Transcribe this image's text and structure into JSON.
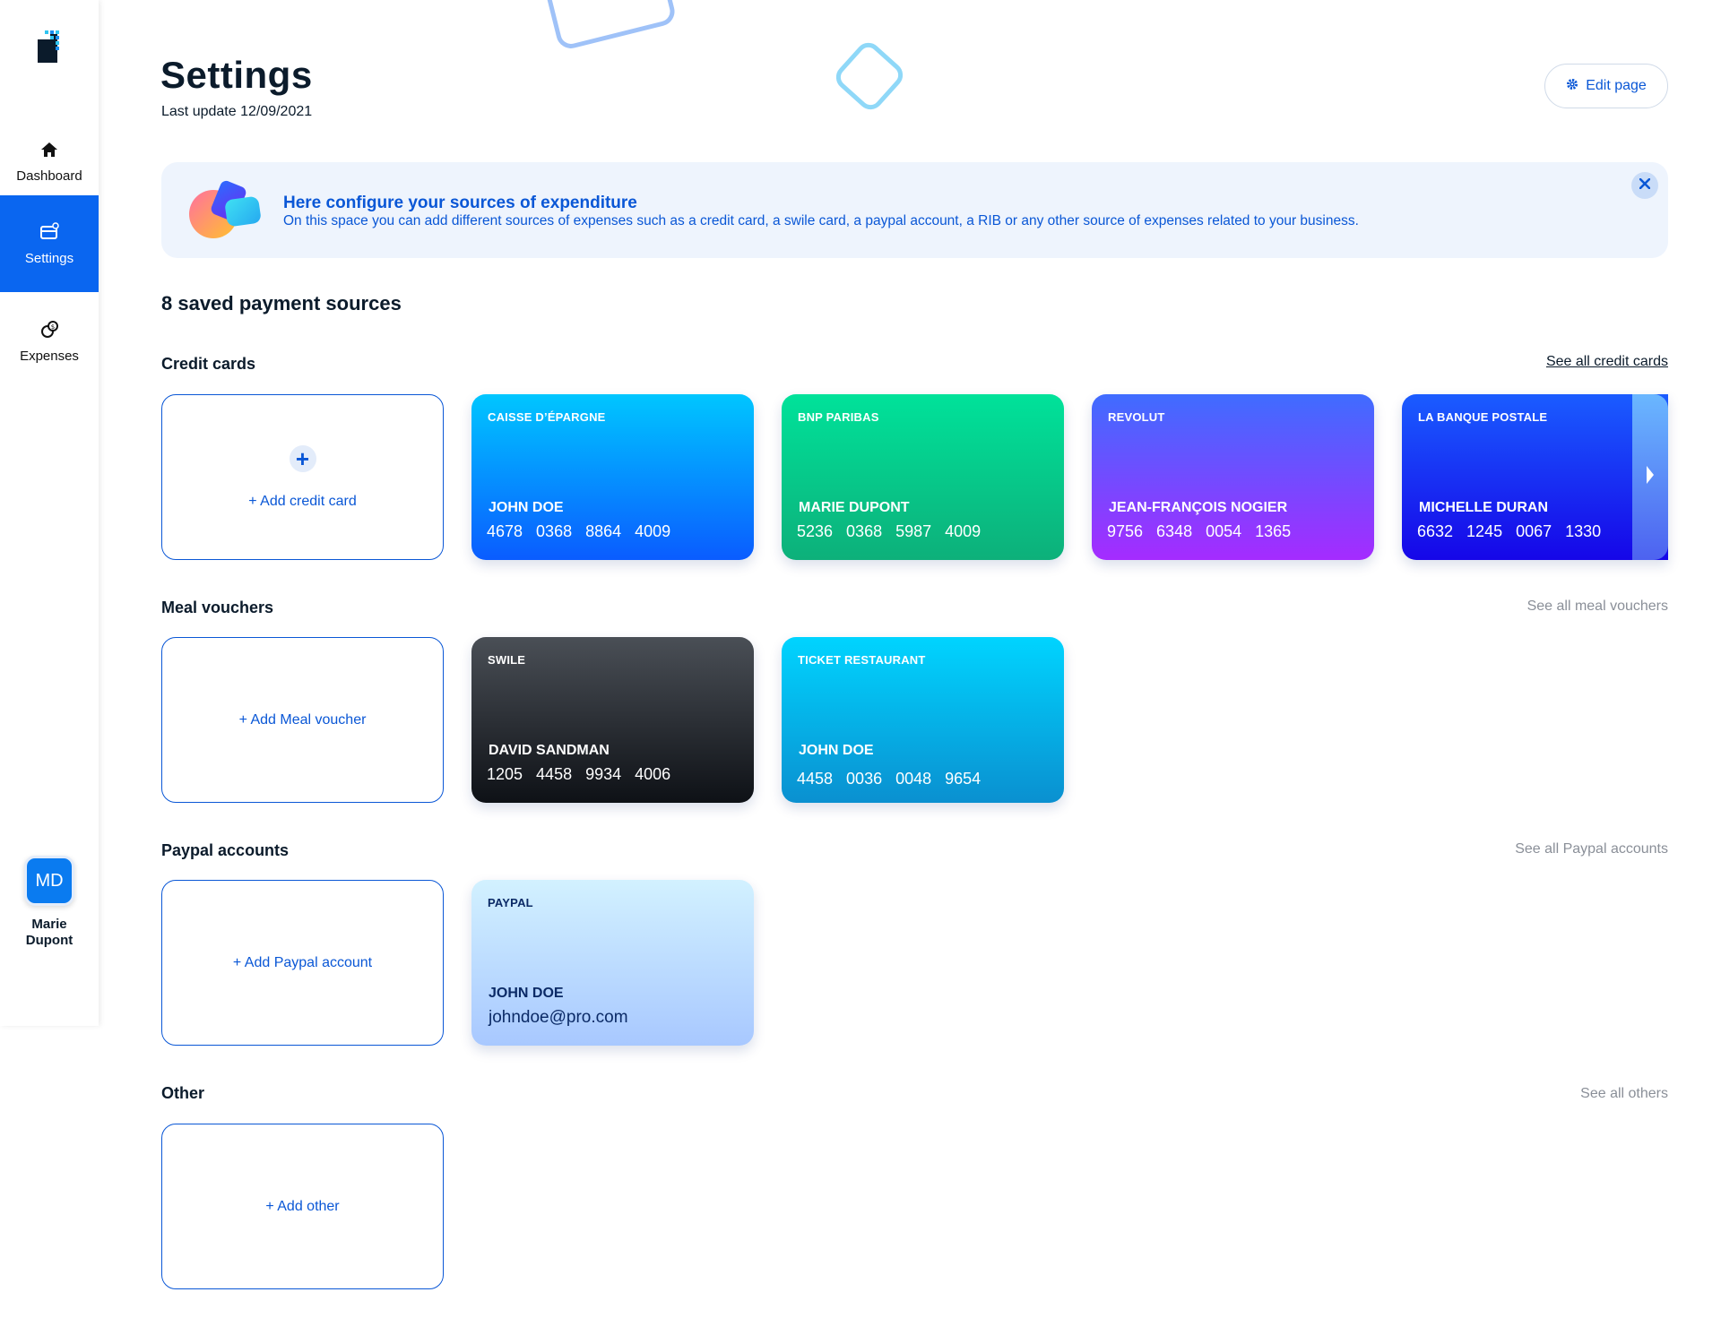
{
  "sidebar": {
    "items": [
      {
        "label": "Dashboard",
        "icon": "home-icon"
      },
      {
        "label": "Settings",
        "icon": "settings-card-icon"
      },
      {
        "label": "Expenses",
        "icon": "expenses-icon"
      }
    ],
    "user": {
      "initials": "MD",
      "first_name": "Marie",
      "last_name": "Dupont"
    }
  },
  "header": {
    "title": "Settings",
    "subtitle": "Last update 12/09/2021",
    "edit_label": "Edit page"
  },
  "banner": {
    "title": "Here configure your sources of expenditure",
    "text": "On this space you can add different sources of expenses such as a credit card, a swile card, a paypal account, a RIB or any other source of expenses related to your business."
  },
  "count_label": "8 saved payment sources",
  "sections": {
    "credit": {
      "title": "Credit cards",
      "see_all": "See all credit cards",
      "add_label": "+ Add credit card",
      "cards": [
        {
          "bank": "CAISSE D’ÉPARGNE",
          "holder": "JOHN DOE",
          "number": "4678 0368 8864 4009"
        },
        {
          "bank": "BNP PARIBAS",
          "holder": "MARIE DUPONT",
          "number": "5236 0368 5987 4009"
        },
        {
          "bank": "REVOLUT",
          "holder": "JEAN-FRANÇOIS NOGIER",
          "number": "9756 6348 0054 1365"
        },
        {
          "bank": "LA BANQUE POSTALE",
          "holder": "MICHELLE DURAN",
          "number": "6632 1245 0067 1330"
        }
      ]
    },
    "meal": {
      "title": "Meal vouchers",
      "see_all": "See all meal vouchers",
      "add_label": "+ Add Meal voucher",
      "cards": [
        {
          "bank": "SWILE",
          "holder": "DAVID SANDMAN",
          "number": "1205 4458 9934 4006"
        },
        {
          "bank": "TICKET RESTAURANT",
          "holder": "JOHN DOE",
          "number": "4458 0036 0048 9654"
        }
      ]
    },
    "paypal": {
      "title": "Paypal accounts",
      "see_all": "See all Paypal accounts",
      "add_label": "+ Add Paypal account",
      "cards": [
        {
          "bank": "PAYPAL",
          "holder": "JOHN DOE",
          "email": "johndoe@pro.com"
        }
      ]
    },
    "other": {
      "title": "Other",
      "see_all": "See all others",
      "add_label": "+ Add other"
    }
  },
  "colors": {
    "accent": "#0a66f0",
    "link": "#0a57d6",
    "banner_bg": "#eef4fd"
  }
}
